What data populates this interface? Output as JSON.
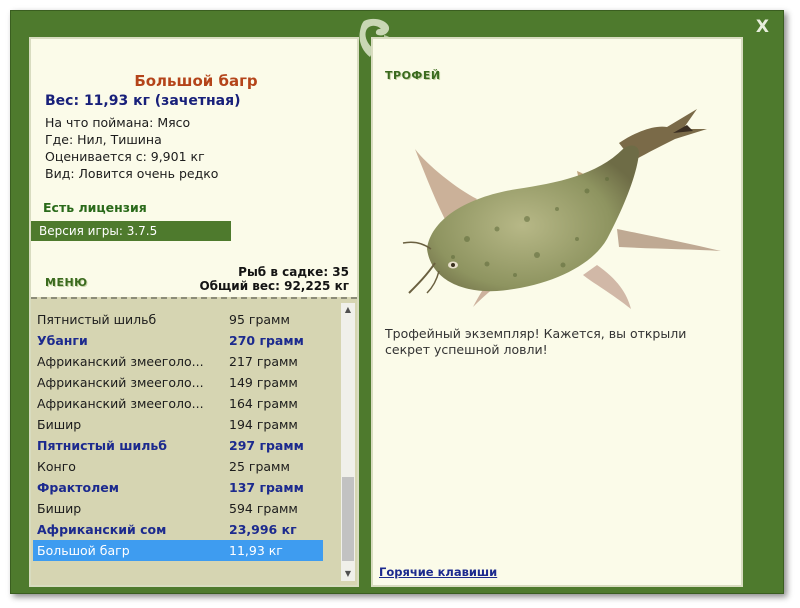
{
  "window": {
    "close_label": "X"
  },
  "fish": {
    "name": "Большой багр",
    "weight": "Вес: 11,93 кг (зачетная)",
    "caught_on": "На что поймана: Мясо",
    "location": "Где: Нил, Тишина",
    "valued_from": "Оценивается с: 9,901 кг",
    "rarity": "Вид: Ловится очень редко"
  },
  "license": "Есть лицензия",
  "version": "Версия игры: 3.7.5",
  "menu_label": "МЕНЮ",
  "stats": {
    "count": "Рыб в садке: 35",
    "total_weight": "Общий вес: 92,225 кг"
  },
  "catch_list": [
    {
      "name": "Пятнистый шильб",
      "weight": "95 грамм",
      "trophy": false
    },
    {
      "name": "Убанги",
      "weight": "270 грамм",
      "trophy": true
    },
    {
      "name": "Африканский змееголо...",
      "weight": "217 грамм",
      "trophy": false
    },
    {
      "name": "Африканский змееголо...",
      "weight": "149 грамм",
      "trophy": false
    },
    {
      "name": "Африканский змееголо...",
      "weight": "164 грамм",
      "trophy": false
    },
    {
      "name": "Бишир",
      "weight": "194 грамм",
      "trophy": false
    },
    {
      "name": "Пятнистый шильб",
      "weight": "297 грамм",
      "trophy": true
    },
    {
      "name": "Конго",
      "weight": "25 грамм",
      "trophy": false
    },
    {
      "name": "Фрактолем",
      "weight": "137 грамм",
      "trophy": true
    },
    {
      "name": "Бишир",
      "weight": "594 грамм",
      "trophy": false
    },
    {
      "name": "Африканский сом",
      "weight": "23,996 кг",
      "trophy": true
    },
    {
      "name": "Большой багр",
      "weight": "11,93 кг",
      "trophy": false,
      "selected": true
    }
  ],
  "trophy_panel": {
    "label": "ТРОФЕЙ",
    "message": "Трофейный экземпляр! Кажется, вы открыли секрет успешной ловли!",
    "hotkeys_link": "Горячие клавиши"
  },
  "colors": {
    "frame": "#4e7a2d",
    "panel": "#fbfbe9",
    "list_bg": "#d6d5b2",
    "selected_row": "#3e9cf0",
    "trophy_text": "#1c2a8e"
  }
}
